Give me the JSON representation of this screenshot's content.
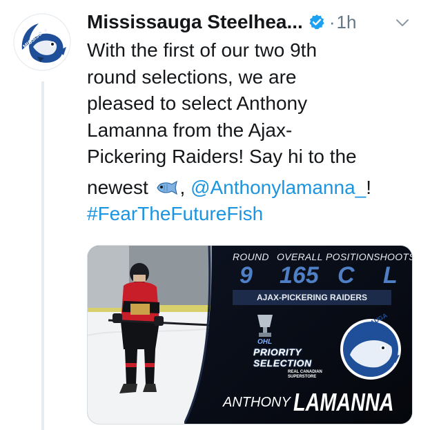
{
  "account": {
    "name": "Mississauga Steelhea...",
    "time": "1h",
    "separator": "·",
    "logo_text": "MISSISSAUGA"
  },
  "tweet": {
    "lines": [
      "With the first of our two 9th",
      "round selections, we are",
      "pleased to select Anthony",
      "Lamanna from the Ajax-",
      "Pickering Raiders! Say hi to the"
    ],
    "newest_prefix": "newest",
    "comma": ",",
    "mention": "@Anthonylamanna_",
    "exclaim": "!",
    "hashtag": "#FearTheFutureFish"
  },
  "media": {
    "headers": [
      "ROUND",
      "OVERALL",
      "POSITION",
      "SHOOTS"
    ],
    "values": [
      "9",
      "165",
      "C",
      "L"
    ],
    "team": "AJAX-PICKERING RAIDERS",
    "priority_line1": "PRIORITY",
    "priority_line2": "SELECTION",
    "sponsor": "REAL CANADIAN SUPERSTORE",
    "league": "OHL",
    "logo_text": "MISSISSAUGA",
    "first_name": "ANTHONY",
    "last_name": "LAMANNA"
  },
  "icons": {
    "verified": "verified-badge-icon",
    "chevron": "chevron-down-icon",
    "fish": "fish-emoji-icon"
  },
  "colors": {
    "link": "#1b95e0",
    "verified": "#1da1f2",
    "muted": "#657786",
    "text": "#14171a",
    "card_bg": "#0a0d14",
    "card_value": "#4f7fc4",
    "team_blue": "#1f4f99"
  }
}
